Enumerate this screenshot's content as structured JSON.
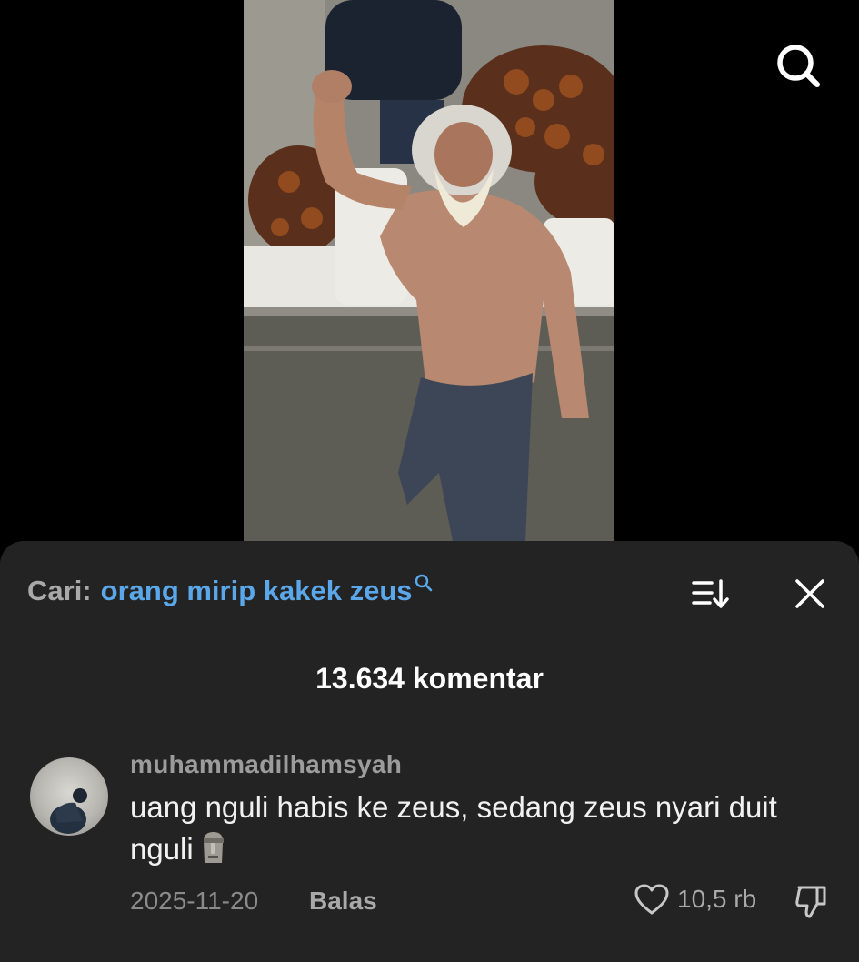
{
  "video": {
    "search_icon": "search-icon"
  },
  "comments_sheet": {
    "search_prefix": "Cari:",
    "search_query": "orang mirip kakek zeus",
    "sort_icon": "sort-icon",
    "close_icon": "close-icon",
    "comment_count": "13.634 komentar"
  },
  "comment": {
    "username": "muhammadilhamsyah",
    "text": "uang nguli habis ke zeus, sedang zeus nyari duit nguli",
    "emoji": "moai-emoji",
    "date": "2025-11-20",
    "reply_label": "Balas",
    "likes": "10,5 rb"
  },
  "colors": {
    "sheet_bg": "#232323",
    "link_blue": "#5aa7ea",
    "muted_text": "#a9a9a9"
  }
}
